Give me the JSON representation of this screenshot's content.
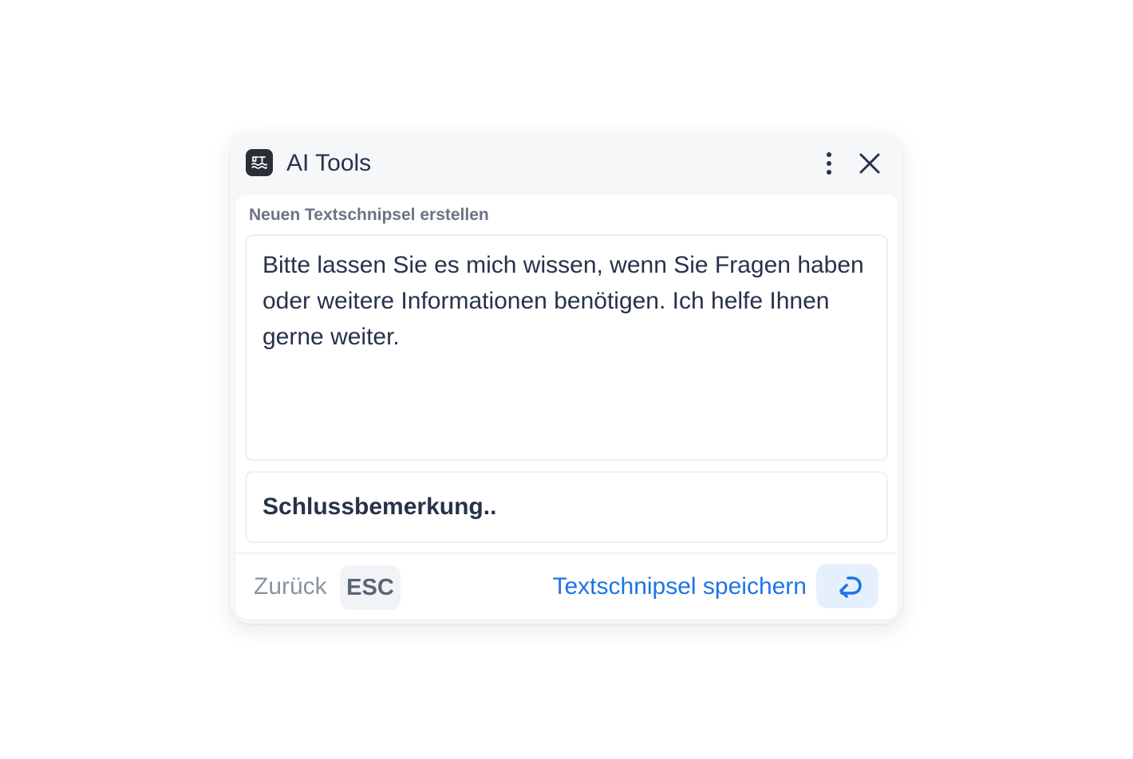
{
  "header": {
    "title": "AI Tools",
    "logo_icon": "languagetool-logo-icon",
    "menu_icon": "kebab-menu-icon",
    "close_icon": "close-icon"
  },
  "form": {
    "section_label": "Neuen Textschnipsel erstellen",
    "snippet_text": "Bitte lassen Sie es mich wissen, wenn Sie Fragen haben oder weitere Informationen benötigen. Ich helfe Ihnen gerne weiter.",
    "snippet_name": "Schlussbemerkung.."
  },
  "footer": {
    "back_label": "Zurück",
    "back_key": "ESC",
    "save_label": "Textschnipsel speichern",
    "save_key_icon": "enter-return-icon"
  },
  "colors": {
    "accent": "#1e74e6",
    "accent_bg": "#e6f0fd",
    "text": "#27324a",
    "muted": "#8a93a4"
  }
}
